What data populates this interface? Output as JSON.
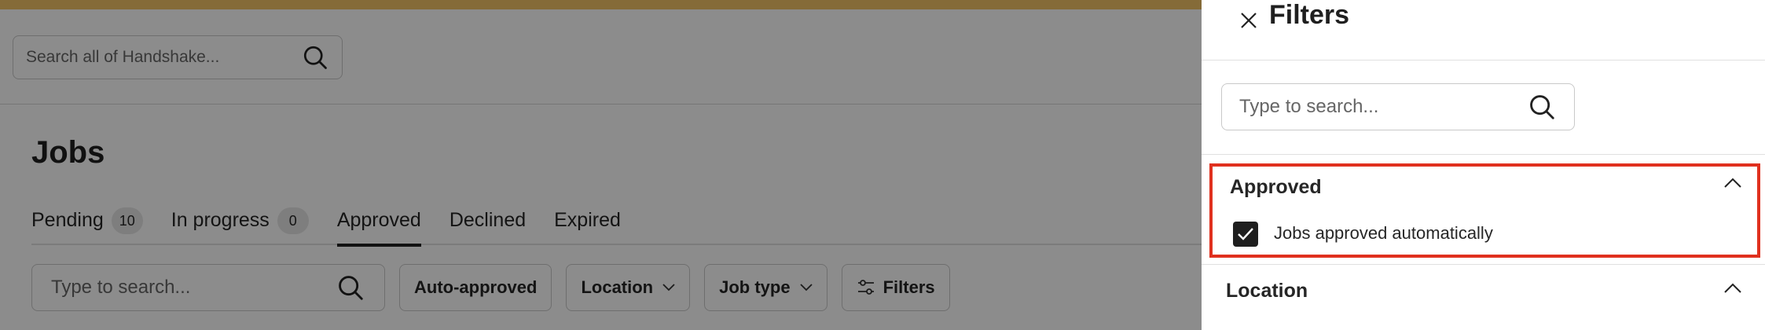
{
  "header": {
    "global_search_placeholder": "Search all of Handshake..."
  },
  "main": {
    "title": "Jobs",
    "tabs": [
      {
        "label": "Pending",
        "count": "10"
      },
      {
        "label": "In progress",
        "count": "0"
      },
      {
        "label": "Approved",
        "count": ""
      },
      {
        "label": "Declined",
        "count": ""
      },
      {
        "label": "Expired",
        "count": ""
      }
    ],
    "active_tab": "Approved",
    "search_placeholder": "Type to search...",
    "filter_buttons": {
      "auto_approved": "Auto-approved",
      "location": "Location",
      "job_type": "Job type",
      "filters": "Filters"
    }
  },
  "panel": {
    "title": "Filters",
    "search_placeholder": "Type to search...",
    "approved_section": {
      "title": "Approved",
      "option_label": "Jobs approved automatically",
      "option_checked": true
    },
    "location_section": {
      "title": "Location"
    }
  },
  "colors": {
    "top_band": "#f2c466",
    "highlight": "#e0301e",
    "checkbox_fill": "#1f1f1f"
  }
}
